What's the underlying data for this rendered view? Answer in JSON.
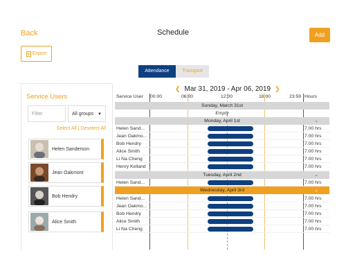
{
  "header": {
    "back_label": "Back",
    "title": "Schedule",
    "add_label": "Add"
  },
  "toolbar": {
    "export_label": "Export"
  },
  "tabs": [
    {
      "label": "Attendance",
      "active": true
    },
    {
      "label": "Transport",
      "active": false
    }
  ],
  "sidebar": {
    "title": "Service Users",
    "filter_placeholder": "Filter",
    "group_select": "All groups",
    "select_all": "Select All | Deselect All",
    "users": [
      {
        "name": "Helen Sanderson"
      },
      {
        "name": "Jean Oakmont"
      },
      {
        "name": "Bob Hendry"
      },
      {
        "name": "Alice Smith"
      }
    ]
  },
  "schedule": {
    "date_range": "Mar 31, 2019 - Apr 06, 2019",
    "columns": {
      "service_user": "Service User",
      "t0": "00:00",
      "t1": "06:00",
      "t2": "12:00",
      "t3": "18:00",
      "t4": "23:59",
      "hours": "Hours"
    },
    "days": [
      {
        "label": "Sunday, March 31st",
        "empty_label": "Empty",
        "rows": []
      },
      {
        "label": "Monday, April 1st",
        "rows": [
          {
            "name": "Helen Sand...",
            "hours": "7.00 hrs"
          },
          {
            "name": "Jean Oakmo...",
            "hours": "7.00 hrs"
          },
          {
            "name": "Bob Hendry",
            "hours": "7.00 hrs"
          },
          {
            "name": "Alice Smith",
            "hours": "7.00 hrs"
          },
          {
            "name": "Li Na Cheng",
            "hours": "7.00 hrs"
          },
          {
            "name": "Henry Kelland",
            "hours": "7.00 hrs"
          }
        ]
      },
      {
        "label": "Tuesday, April 2nd",
        "rows": [
          {
            "name": "Helen Sand...",
            "hours": "7.00 hrs"
          }
        ]
      },
      {
        "label": "Wednesday, April 3rd",
        "highlight": true,
        "rows": [
          {
            "name": "Helen Sand...",
            "hours": "7.00 hrs"
          },
          {
            "name": "Jean Oakmo...",
            "hours": "7.00 hrs"
          },
          {
            "name": "Bob Hendry",
            "hours": "7.00 hrs"
          },
          {
            "name": "Alice Smith",
            "hours": "7.00 hrs"
          },
          {
            "name": "Li Na Cheng",
            "hours": "7.00 hrs"
          }
        ]
      }
    ]
  },
  "colors": {
    "accent": "#f0a020",
    "primary": "#0e3f80"
  }
}
